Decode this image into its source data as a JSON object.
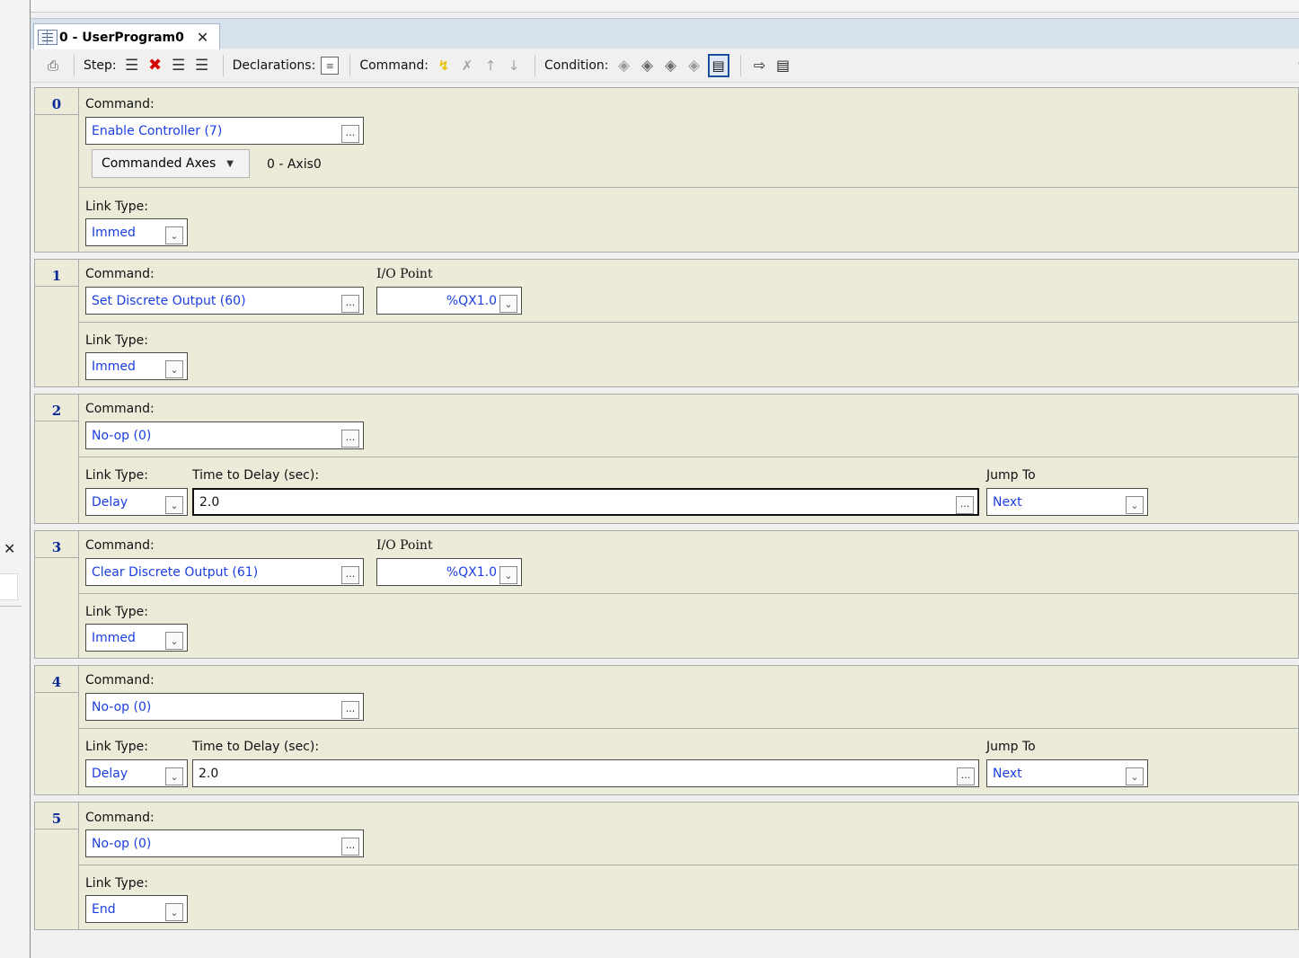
{
  "tab": {
    "title": "0 - UserProgram0"
  },
  "toolbar": {
    "step_label": "Step:",
    "declarations_label": "Declarations:",
    "command_label": "Command:",
    "condition_label": "Condition:"
  },
  "labels": {
    "command": "Command:",
    "link_type": "Link Type:",
    "io_point": "I/O Point",
    "time_delay": "Time to Delay (sec):",
    "jump_to": "Jump To",
    "ellipsis": "...",
    "commanded_axes": "Commanded Axes"
  },
  "steps": [
    {
      "num": "0",
      "command": "Enable Controller (7)",
      "axis_value": "0 - Axis0",
      "link_type": "Immed"
    },
    {
      "num": "1",
      "command": "Set Discrete Output (60)",
      "io_point": "%QX1.0",
      "link_type": "Immed"
    },
    {
      "num": "2",
      "command": "No-op (0)",
      "link_type": "Delay",
      "delay": "2.0",
      "jump_to": "Next"
    },
    {
      "num": "3",
      "command": "Clear Discrete Output (61)",
      "io_point": "%QX1.0",
      "link_type": "Immed"
    },
    {
      "num": "4",
      "command": "No-op (0)",
      "link_type": "Delay",
      "delay": "2.0",
      "jump_to": "Next"
    },
    {
      "num": "5",
      "command": "No-op (0)",
      "link_type": "End"
    }
  ]
}
